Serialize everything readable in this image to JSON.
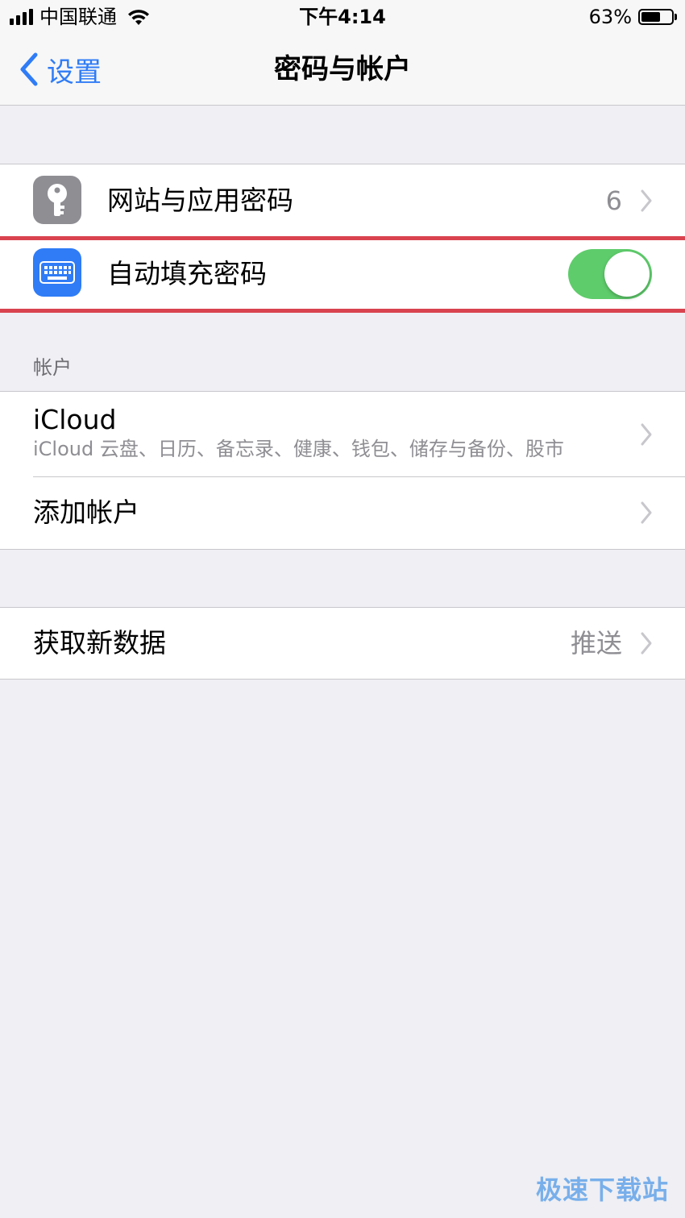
{
  "status_bar": {
    "carrier": "中国联通",
    "time": "下午4:14",
    "battery_percent": "63%",
    "battery_level": 0.63,
    "signal_icon": "signal-bars-icon",
    "wifi_icon": "wifi-icon",
    "battery_icon": "battery-icon"
  },
  "nav": {
    "back_label": "设置",
    "title": "密码与帐户",
    "back_icon": "chevron-left-icon"
  },
  "passwords_group": {
    "website_passwords": {
      "label": "网站与应用密码",
      "count": "6",
      "icon": "key-icon",
      "icon_bg": "#8e8e93"
    },
    "autofill": {
      "label": "自动填充密码",
      "enabled": true,
      "icon": "keyboard-icon",
      "icon_bg": "#2f7cf6"
    }
  },
  "accounts_section": {
    "header": "帐户",
    "icloud": {
      "title": "iCloud",
      "subtitle": "iCloud 云盘、日历、备忘录、健康、钱包、储存与备份、股市"
    },
    "add_account": {
      "label": "添加帐户"
    }
  },
  "fetch_group": {
    "label": "获取新数据",
    "value": "推送"
  },
  "watermark": "极速下载站",
  "colors": {
    "accent": "#2f7cf6",
    "toggle_on": "#5ecc6b",
    "highlight": "#d9434f",
    "background": "#efeff4"
  }
}
